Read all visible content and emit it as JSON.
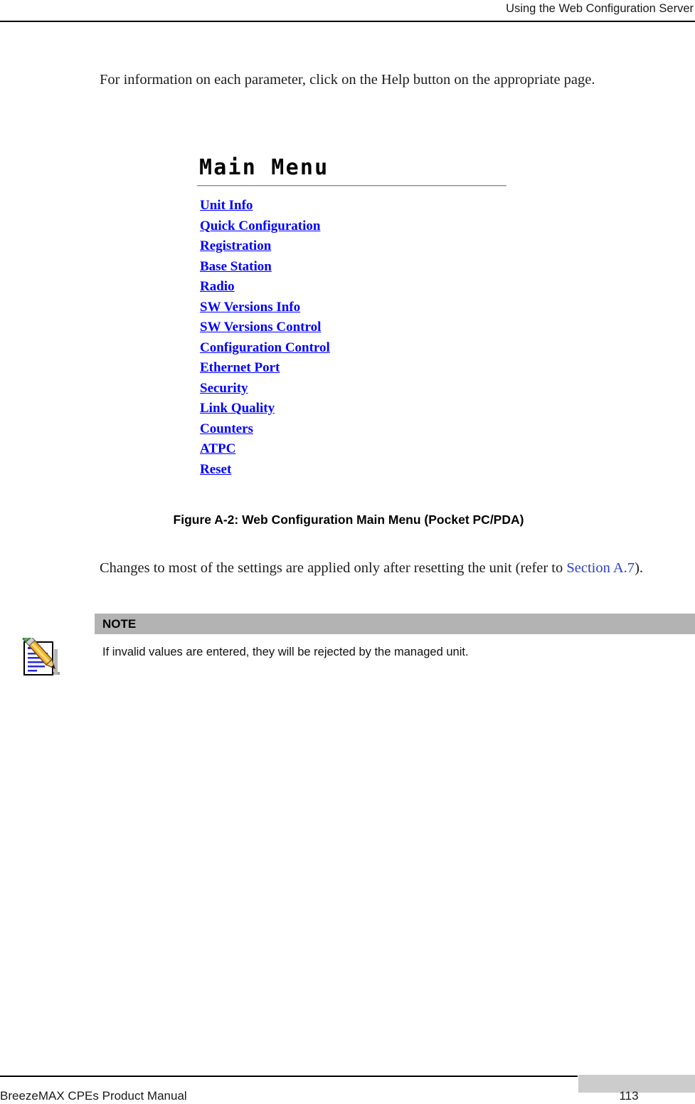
{
  "header": {
    "title": "Using the Web Configuration Server"
  },
  "intro": {
    "paragraph": "For information on each parameter, click on the Help button on the appropriate page."
  },
  "figure": {
    "screenshot": {
      "title": "Main Menu",
      "menu_items": [
        "Unit Info",
        "Quick Configuration",
        "Registration",
        "Base Station",
        "Radio",
        "SW Versions Info",
        "SW Versions Control",
        "Configuration Control",
        "Ethernet Port",
        "Security",
        "Link Quality",
        "Counters",
        "ATPC",
        "Reset"
      ],
      "link_color": "#0000ff"
    },
    "caption": "Figure A-2: Web Configuration Main Menu (Pocket PC/PDA)"
  },
  "reset_note": {
    "text_before": "Changes to most of the settings are applied only after resetting the unit (refer to ",
    "link_text": "Section A.7",
    "text_after": ")."
  },
  "note": {
    "label": "NOTE",
    "body": "If invalid values are entered, they will be rejected by the managed unit.",
    "band_color": "#b3b3b3"
  },
  "footer": {
    "manual_title": "BreezeMAX CPEs Product Manual",
    "page_number": "113"
  }
}
